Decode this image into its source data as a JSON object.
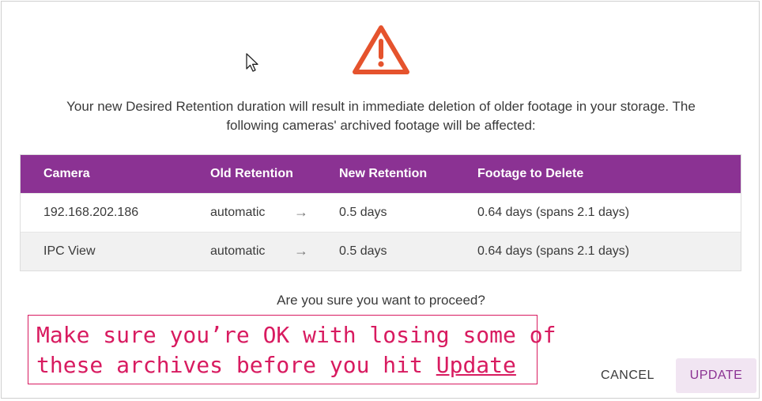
{
  "dialog": {
    "icon": "warning-triangle-icon",
    "accent_color": "#e5532d",
    "message_line1": "Your new Desired Retention duration will result in immediate deletion of older footage in your storage. The",
    "message_line2": "following cameras' archived footage will be affected:",
    "question": "Are you sure you want to proceed?"
  },
  "table": {
    "header_color": "#8b3293",
    "columns": [
      "Camera",
      "Old Retention",
      "New Retention",
      "Footage to Delete"
    ],
    "rows": [
      {
        "camera": "192.168.202.186",
        "old": "automatic",
        "arrow": "→",
        "new": "0.5 days",
        "delete": "0.64 days (spans 2.1 days)"
      },
      {
        "camera": "IPC View",
        "old": "automatic",
        "arrow": "→",
        "new": "0.5 days",
        "delete": "0.64 days (spans 2.1 days)"
      }
    ]
  },
  "callout": {
    "color": "#d81b60",
    "line1": "Make sure you’re OK with losing some of",
    "line2_prefix": "these archives before you hit ",
    "line2_link": "Update"
  },
  "buttons": {
    "cancel_label": "CANCEL",
    "update_label": "UPDATE"
  }
}
